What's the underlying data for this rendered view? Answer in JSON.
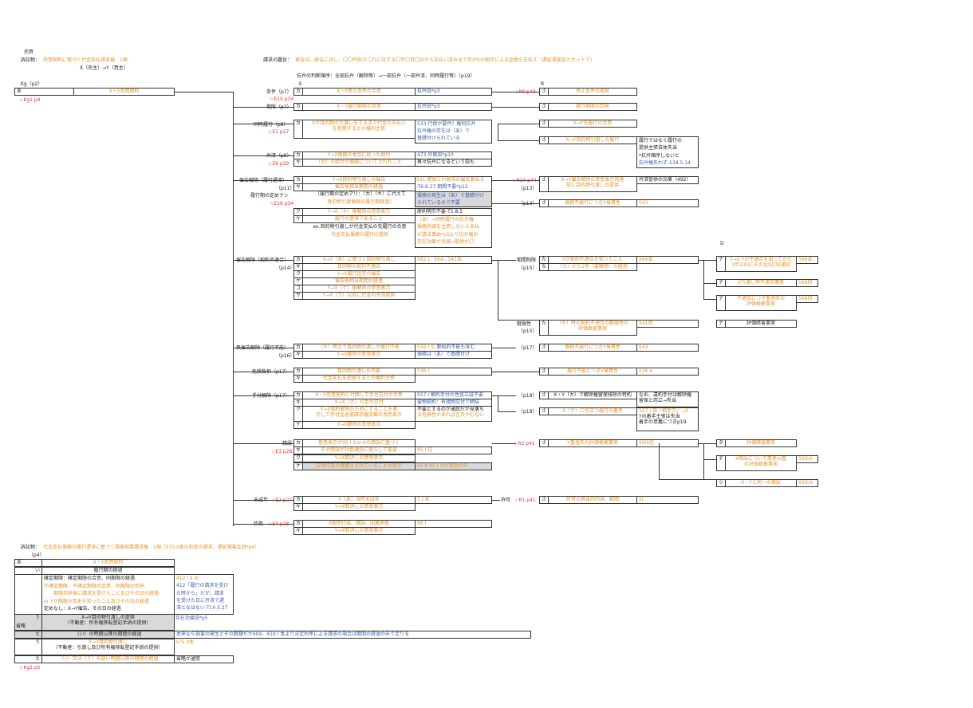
{
  "header": {
    "title": "売買",
    "claim_label": "訴訟物：",
    "claim_value": "売買契約に基づく代金支払請求権　1個",
    "parties": "X（売主）→Y（買主）",
    "intent_label": "請求の趣旨：",
    "intent_value": "被告は、原告に対し、〇〇円及びこれに対する〇年〇月〇日から支払い済みまで年X％の割合による金員を支払え（遅延損害金とセットで）",
    "order_note": "抗弁の判断順序：全部抗弁（解除等）→一部抗弁（一部弁済、同時履行等）（p19）"
  },
  "columns": {
    "kg": "Kg（p2）",
    "e": "E",
    "r": "R",
    "d": "D"
  },
  "kg": {
    "a": "あ",
    "a_text": "X・Y売買契約",
    "ref": "☆Kg1 p4"
  },
  "e_rows": [
    {
      "name": "条件（p7）",
      "ka": "カ",
      "text": "X・Y停止条件の合意",
      "note": "抗弁説*p3",
      "ref": "☆E15 p34"
    },
    {
      "name": "期限（p7）",
      "ka": "カ",
      "text": "X・Y履行期限の合意",
      "note": "抗弁説*p3"
    },
    {
      "name": "同時履行（p8）",
      "ka": "カ",
      "text1": "Xが目的物の引渡しをするまで代金の支払い",
      "text2": "を拒絶するとの権利主張",
      "note1": "533 行使が要件？権利抗弁",
      "note2": "抗弁権の存在は（あ）で",
      "note3": "基礎付けられている",
      "ref": "☆E1 p27"
    },
    {
      "name": "弁済（p9）",
      "ka": "カ",
      "ki": "キ",
      "text1": "Y→X債務の本旨に従った給付",
      "text2": "（カ）の給付が債務についてされたこと",
      "note1": "473 外側説*p10",
      "note2": "再々抗弁になるという説も",
      "ref": "☆E6 p29"
    },
    {
      "name": "催告解除（履行遅滞）",
      "sub": "（p11）",
      "sub2": "履行期の定めナシ",
      "ref": "☆E16 p34"
    }
  ],
  "saikoku": {
    "ka": "Y→X目的物引渡しの催告",
    "ki": "催告後相当期間の経過",
    "ki_note": "-T6.6.27 期間不要*p12",
    "note1": "541 期間と付遅滞の催告兼ねる",
    "bracket": "（履行期の定めアリ：（カ）（キ）に代えて",
    "bracket2": "目的物引渡債務の履行期経過）",
    "gray1": "債務の発生は（あ）で基礎付け",
    "gray2": "られているので不要",
    "ku": "ク",
    "ku_text": "Y→X（キ）後解除の意思表示",
    "ku_note": "原則明示不要-T1.8.5",
    "ke": "ケ",
    "ke_text": "履行が遅滞であること",
    "ex1": "ex.目的物引渡しが代金支払の先履行の合意",
    "ex2": "代金支払債務の履行の提供",
    "ke_note1": "（あ）→同時履行の抗弁権",
    "ke_note2": "債務消滅を主張しないと未払",
    "ke_note3": "が違法事由*p5より抗弁権の",
    "ke_note4": "存在効果が消滅→提供が〇"
  },
  "r_items": [
    {
      "ref": "☆R9 p43",
      "sa": "さ",
      "text": "停止条件の成就"
    },
    {
      "sa": "さ",
      "text": "履行期限の到来"
    },
    {
      "sa": "さ",
      "text": "X→Y先履行の合意"
    },
    {
      "sa": "さ",
      "text": "X→Y目的物引渡しの履行",
      "note1": "履行ではなく履行の",
      "note2": "提供主張自体失当",
      "note3": "*抗弁順序しないと",
      "note4": "抗弁権失わず-S34.5.14"
    },
    {
      "ref": "☆R10 p44",
      "sub": "（p13）",
      "sa": "さ",
      "text1": "X→Y催告解除の意思表示到達",
      "text2": "前に目的物引渡しの提供",
      "note": "弁済提供の効果（492）"
    },
    {
      "sub": "（p13）",
      "sa": "さ",
      "text": "債務不履行につきY帰責性",
      "note": "543"
    }
  ],
  "keiyaku": {
    "name": "催告解除（契約不適合）",
    "sub": "（p14）",
    "ka": "X→Y（あ）に基づく目的物引渡し",
    "ka_note": "562 I、564、541本",
    "ki": "目的物の契約不適合",
    "ku": "Y→X履行追完の催告",
    "ke": "催告後相当期間の経過",
    "ko": "Y→X（ケ）後解除の意思表示",
    "sa": "Y→X（ク）以前に代金の弁済提供",
    "r_name": "期間制限",
    "r_sub": "（p15）",
    "r_ta": "た",
    "r_ta_text": "Yが契約不適合を知ったこと",
    "r_ta_note": "566本",
    "r_chi": "ち",
    "r_chi_text": "（た）から1年（要解除）の経過",
    "r2_name": "軽微性",
    "r2_sub": "（p15）",
    "r2_ta": "た",
    "r2_ta_text": "（キ）時の契約不適合の軽微性の",
    "r2_ta_text2": "評価根拠事実",
    "r2_note": "541但",
    "d_na": "ナ",
    "d1": "Y→X Yが不適合を知ってから",
    "d1b": "1年以内にその旨X訂知通知",
    "d1_note": "566本",
    "d2": "X引渡し時不適合悪意",
    "d2_note": "566但",
    "d3": "不適合につき重過失の",
    "d3b": "評価根拠事実",
    "d3_note": "566但",
    "d4": "評価障害事実"
  },
  "muriko": {
    "name": "無催告解除（履行不能）",
    "sub": "（p16）",
    "ka": "（キ）時点で目的物引渡しが履行不能",
    "ka_note1": "542 I ①",
    "ka_note2": "原始的不能も含む",
    "ki": "Y→X解除の意思表示",
    "ki_note": "債務は（あ）で基礎付け",
    "r_sub": "（p17）",
    "r_text": "債務不履行につきY帰責性",
    "r_note": "543"
  },
  "kiken": {
    "name": "危険負担（p17）",
    "ka": "目的物引渡しの不能",
    "ka_note": "536 I",
    "ki": "代金支払を拒絶するとの権利主張",
    "r_text": "履行不能につきY帰責性",
    "r_note": "536 II"
  },
  "tetsuke": {
    "name": "手付解除（p17）",
    "ka": "X・Y売買契約に付随して手付交付の合意",
    "ka_note": "557 I 解約手付の性質立証不要",
    "ki": "X→X（カ）の手付交付",
    "ki_note": "要物契約：有価物交付で締結",
    "ku1": "Y→X契約解除のためにすることを表",
    "ku2": "示して手付金返還請求権放棄の意思表示",
    "ku_note1": "不要とするのが通説だが見落ち",
    "ku_note2": "る危険性があれば言及やむない",
    "ke": "Y→X解除の意思表示",
    "r1_sub": "（p18）",
    "r1_text": "X・Y（カ）で解除権留保排除の特約",
    "r1_note1": "なお、違約手付は解除権",
    "r1_note2": "留保と両立→失当",
    "r2_sub": "（p18）",
    "r2_text": "X（ケ）に先立つ履行の着手",
    "r2_note1": "557 I 但「相手方」→X",
    "r2_note2": "Yの着手主張は失当",
    "r2_note3": "着手の意義につきp19"
  },
  "sakugo": {
    "name": "錯誤",
    "ref": "☆E3 p28",
    "ka": "意思表示が95 I ①or②の錯誤に基づく",
    "ki": "その錯誤が社会通念に照らして重要",
    "ki_note": "95 I 柱",
    "ku": "Y→X取消しの意思表示",
    "ke": "法律行為の基礎とされていることの表示",
    "ke_note": "95 II 95 I ②の場合のみ",
    "r_ref": "☆R2 p41",
    "r_text": "Y重過失の評価根拠事実",
    "r_note": "95III柱",
    "d_ta": "タ",
    "d1": "評価障害事実",
    "d_chi": "チ",
    "d2": "X錯誤について悪意or重",
    "d2b": "の評価根拠事実",
    "d2_note": "95III①",
    "d_tsu": "ツ",
    "d3": "X・Yと同一の錯誤",
    "d3_note": "95III②"
  },
  "miseinen": {
    "name": "未成年",
    "ref": "☆E2 p27",
    "ka": "Y（あ）当時未成年",
    "ka_note": "5 I 本",
    "ki": "Y→X取消しの意思表示",
    "r_name": "許可",
    "r_ref": "☆R1 p41",
    "r_text": "許可の具体的内容、範囲",
    "r_note": "5I"
  },
  "sagi": {
    "name": "詐欺",
    "ref": "☆E4 p28",
    "ka": "X欺罔行為、錯誤、因果関係",
    "ka_note": "96 I",
    "ki": "Y→X取消しの意思表示"
  },
  "second": {
    "claim_label": "訴訟物：",
    "claim_value": "代金支払債務の履行遅滞に基づく損害賠償請求権　1個（575 II本の利息の請求、遅延損害金説*p4）",
    "sub": "（p4）",
    "a": "あ",
    "a_text": "X・Y売買契約",
    "i": "い",
    "i_text": "履行期の経過",
    "l1": "確定期限：確定期限の合意、同期限の経過",
    "l2": "不確定期限：不確定期限の合意、同期限の到来、",
    "l3": "　　期限到来後に請求を受けたこと及びその日の経過",
    "l4": "or Yが期限の到来を知ったこと及びその日の経過",
    "l5": "定めなし：X→Y催告、その日の経過",
    "n1": "412 I II III",
    "n2": "412「履行の請求を受け",
    "n3": "た時から」だが、請求",
    "n4": "を受けた日に弁済で遅",
    "n5": "滞となはない-T10.5.27",
    "u": "う",
    "u_text": "X→Y目的物引渡しの提供",
    "u_text2": "（不動産：所有権移転登記手続の提供）",
    "u_note": "存在効果説*p5",
    "e": "え",
    "e_text": "（い）の時期以降の期間の経過",
    "e_note": "本来なら損害の発生とその数額だが404、419 I 本より法定利率による請求の場合は期間の経過のみで足りる",
    "shoryaku": "省略",
    "u2": "う",
    "u2_text": "X→Y目的物引渡し",
    "u2_text2": "（不動産：引渡し及び所有権移転登記手続の提供）",
    "u2_note": "575 II本",
    "e2": "え",
    "e2_text": "（い）又は（う）の遅い時期以降の期間の経過",
    "e2_note": "省略が通常",
    "ref": "☆Kg2 p5"
  }
}
